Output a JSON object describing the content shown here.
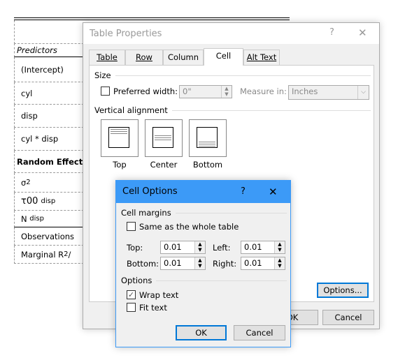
{
  "document": {
    "rows": [
      "Predictors",
      "(Intercept)",
      "cyl",
      "disp",
      "cyl * disp",
      "Random Effects",
      "σ",
      "2",
      "τ00",
      "disp",
      "N",
      "disp",
      "Observations",
      "Marginal R",
      "2",
      " /"
    ]
  },
  "table_properties": {
    "title": "Table Properties",
    "help": "?",
    "close": "✕",
    "tabs": [
      "Table",
      "Row",
      "Column",
      "Cell",
      "Alt Text"
    ],
    "active_tab": "Cell",
    "size_label": "Size",
    "preferred_width_label": "Preferred width:",
    "preferred_width_checked": false,
    "preferred_width_value": "0\"",
    "measure_in_label": "Measure in:",
    "measure_in_value": "Inches",
    "vertical_alignment_label": "Vertical alignment",
    "alignments": [
      "Top",
      "Center",
      "Bottom"
    ],
    "options_button": "Options...",
    "ok_button": "OK",
    "cancel_button": "Cancel"
  },
  "cell_options": {
    "title": "Cell Options",
    "help": "?",
    "close": "✕",
    "cell_margins_label": "Cell margins",
    "same_as_table_label": "Same as the whole table",
    "same_as_table_checked": false,
    "top_label": "Top:",
    "top_value": "0.01",
    "bottom_label": "Bottom:",
    "bottom_value": "0.01",
    "left_label": "Left:",
    "left_value": "0.01",
    "right_label": "Right:",
    "right_value": "0.01",
    "options_label": "Options",
    "wrap_text_label": "Wrap text",
    "wrap_text_checked": true,
    "fit_text_label": "Fit text",
    "fit_text_checked": false,
    "ok_button": "OK",
    "cancel_button": "Cancel",
    "accent": "#3c9af7"
  }
}
